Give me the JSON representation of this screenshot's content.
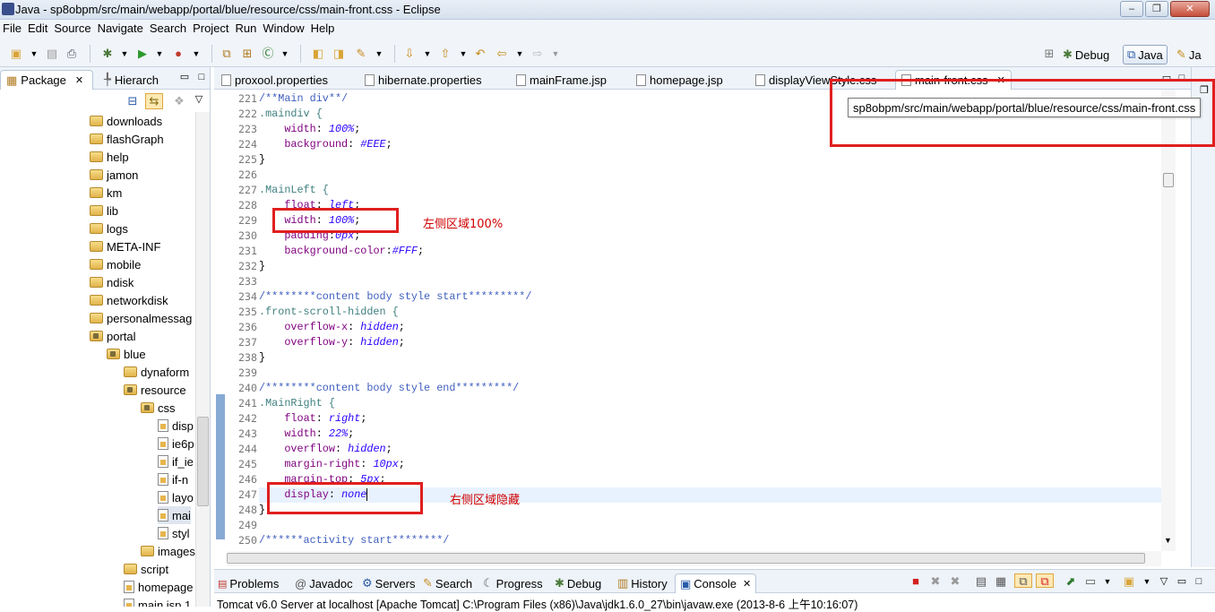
{
  "window": {
    "title": "Java - sp8obpm/src/main/webapp/portal/blue/resource/css/main-front.css - Eclipse",
    "min": "–",
    "max": "❐",
    "close": "✕"
  },
  "menu": [
    "File",
    "Edit",
    "Source",
    "Navigate",
    "Search",
    "Project",
    "Run",
    "Window",
    "Help"
  ],
  "perspectives": {
    "debug": "Debug",
    "java": "Java",
    "other": "Ja"
  },
  "package_explorer": {
    "tabs": [
      {
        "label": "Package"
      },
      {
        "label": "Hierarch"
      }
    ],
    "tree": [
      {
        "label": "downloads"
      },
      {
        "label": "flashGraph"
      },
      {
        "label": "help"
      },
      {
        "label": "jamon"
      },
      {
        "label": "km"
      },
      {
        "label": "lib"
      },
      {
        "label": "logs"
      },
      {
        "label": "META-INF"
      },
      {
        "label": "mobile"
      },
      {
        "label": "ndisk"
      },
      {
        "label": "networkdisk"
      },
      {
        "label": "personalmessag"
      },
      {
        "label": "portal"
      },
      {
        "label": "blue"
      },
      {
        "label": "dynaform"
      },
      {
        "label": "resource"
      },
      {
        "label": "css"
      },
      {
        "label": "disp"
      },
      {
        "label": "ie6p"
      },
      {
        "label": "if_ie"
      },
      {
        "label": "if-n"
      },
      {
        "label": "layo"
      },
      {
        "label": "mai"
      },
      {
        "label": "styl"
      },
      {
        "label": "images"
      },
      {
        "label": "script"
      },
      {
        "label": "homepage"
      },
      {
        "label": "main.jsp 1"
      }
    ]
  },
  "editor": {
    "tabs": [
      {
        "label": "proxool.properties"
      },
      {
        "label": "hibernate.properties"
      },
      {
        "label": "mainFrame.jsp"
      },
      {
        "label": "homepage.jsp"
      },
      {
        "label": "displayViewStyle.css"
      },
      {
        "label": "main-front.css"
      }
    ],
    "tooltip": "sp8obpm/src/main/webapp/portal/blue/resource/css/main-front.css",
    "lines": [
      {
        "n": "221",
        "t": "/**Main div**/",
        "k": "cmt"
      },
      {
        "n": "222",
        "t": ".maindiv {",
        "k": "sel"
      },
      {
        "n": "223",
        "p": "width",
        "v": "100%"
      },
      {
        "n": "224",
        "p": "background",
        "v": "#EEE"
      },
      {
        "n": "225",
        "t": "}",
        "k": "pun"
      },
      {
        "n": "226",
        "t": "",
        "k": "pun"
      },
      {
        "n": "227",
        "t": ".MainLeft {",
        "k": "sel"
      },
      {
        "n": "228",
        "p": "float",
        "v": "left"
      },
      {
        "n": "229",
        "p": "width",
        "v": "100%"
      },
      {
        "n": "230",
        "p": "padding",
        "v": "0px",
        "ns": true
      },
      {
        "n": "231",
        "p": "background-color",
        "v": "#FFF",
        "ns": true
      },
      {
        "n": "232",
        "t": "}",
        "k": "pun"
      },
      {
        "n": "233",
        "t": "",
        "k": "pun"
      },
      {
        "n": "234",
        "t": "/********content body style start*********/",
        "k": "cmt"
      },
      {
        "n": "235",
        "t": ".front-scroll-hidden {",
        "k": "sel"
      },
      {
        "n": "236",
        "p": "overflow-x",
        "v": "hidden"
      },
      {
        "n": "237",
        "p": "overflow-y",
        "v": "hidden"
      },
      {
        "n": "238",
        "t": "}",
        "k": "pun"
      },
      {
        "n": "239",
        "t": "",
        "k": "pun"
      },
      {
        "n": "240",
        "t": "/********content body style end*********/",
        "k": "cmt"
      },
      {
        "n": "241",
        "t": ".MainRight {",
        "k": "sel"
      },
      {
        "n": "242",
        "p": "float",
        "v": "right"
      },
      {
        "n": "243",
        "p": "width",
        "v": "22%"
      },
      {
        "n": "244",
        "p": "overflow",
        "v": "hidden"
      },
      {
        "n": "245",
        "p": "margin-right",
        "v": "10px"
      },
      {
        "n": "246",
        "p": "margin-top",
        "v": "5px"
      },
      {
        "n": "247",
        "p": "display",
        "v": "none",
        "nosemi": true
      },
      {
        "n": "248",
        "t": "}",
        "k": "pun"
      },
      {
        "n": "249",
        "t": "",
        "k": "pun"
      },
      {
        "n": "250",
        "t": "/******activity start********/",
        "k": "cmt"
      }
    ],
    "annotations": {
      "left": "左侧区域100%",
      "right": "右侧区域隐藏"
    }
  },
  "console": {
    "tabs": [
      {
        "label": "Problems"
      },
      {
        "label": "Javadoc"
      },
      {
        "label": "Servers"
      },
      {
        "label": "Search"
      },
      {
        "label": "Progress"
      },
      {
        "label": "Debug"
      },
      {
        "label": "History"
      },
      {
        "label": "Console"
      }
    ],
    "status": "Tomcat v6.0 Server at localhost [Apache Tomcat] C:\\Program Files (x86)\\Java\\jdk1.6.0_27\\bin\\javaw.exe (2013-8-6 上午10:16:07)"
  },
  "colors": {
    "annotation_red": "#e01f1f",
    "comment": "#3f5fbf",
    "property": "#7f007f",
    "value": "#2a00ff"
  }
}
